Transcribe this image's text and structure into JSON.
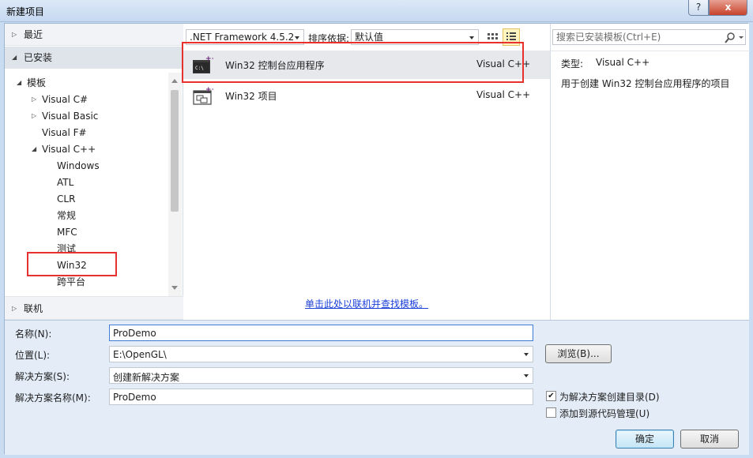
{
  "window": {
    "title": "新建项目",
    "help_glyph": "?",
    "close_glyph": "x"
  },
  "left_tree": {
    "recent": "最近",
    "installed": "已安装",
    "templates": "模板",
    "items": [
      {
        "label": "Visual C#"
      },
      {
        "label": "Visual Basic"
      },
      {
        "label": "Visual F#"
      },
      {
        "label": "Visual C++"
      },
      {
        "label": "Windows"
      },
      {
        "label": "ATL"
      },
      {
        "label": "CLR"
      },
      {
        "label": "常规"
      },
      {
        "label": "MFC"
      },
      {
        "label": "测试"
      },
      {
        "label": "Win32"
      },
      {
        "label": "跨平台"
      }
    ],
    "online": "联机"
  },
  "toolbar": {
    "framework": ".NET Framework 4.5.2",
    "sort_label": "排序依据:",
    "sort_value": "默认值"
  },
  "templates": [
    {
      "name": "Win32 控制台应用程序",
      "lang": "Visual C++",
      "icon": "console-app-icon"
    },
    {
      "name": "Win32 项目",
      "lang": "Visual C++",
      "icon": "win32-project-icon"
    }
  ],
  "online_link": "单击此处以联机并查找模板。",
  "right_pane": {
    "search_placeholder": "搜索已安装模板(Ctrl+E)",
    "type_label": "类型:",
    "type_value": "Visual C++",
    "description": "用于创建 Win32 控制台应用程序的项目"
  },
  "form": {
    "name_label": "名称(N):",
    "name_value": "ProDemo",
    "location_label": "位置(L):",
    "location_value": "E:\\OpenGL\\",
    "solution_label": "解决方案(S):",
    "solution_value": "创建新解决方案",
    "solution_name_label": "解决方案名称(M):",
    "solution_name_value": "ProDemo",
    "browse": "浏览(B)...",
    "create_dir_label": "为解决方案创建目录(D)",
    "create_dir_checked": true,
    "source_control_label": "添加到源代码管理(U)",
    "source_control_checked": false,
    "ok": "确定",
    "cancel": "取消"
  },
  "colors": {
    "highlight_box": "#e6312f",
    "link": "#1a3fd8",
    "form_bg": "#e3ecf7"
  }
}
